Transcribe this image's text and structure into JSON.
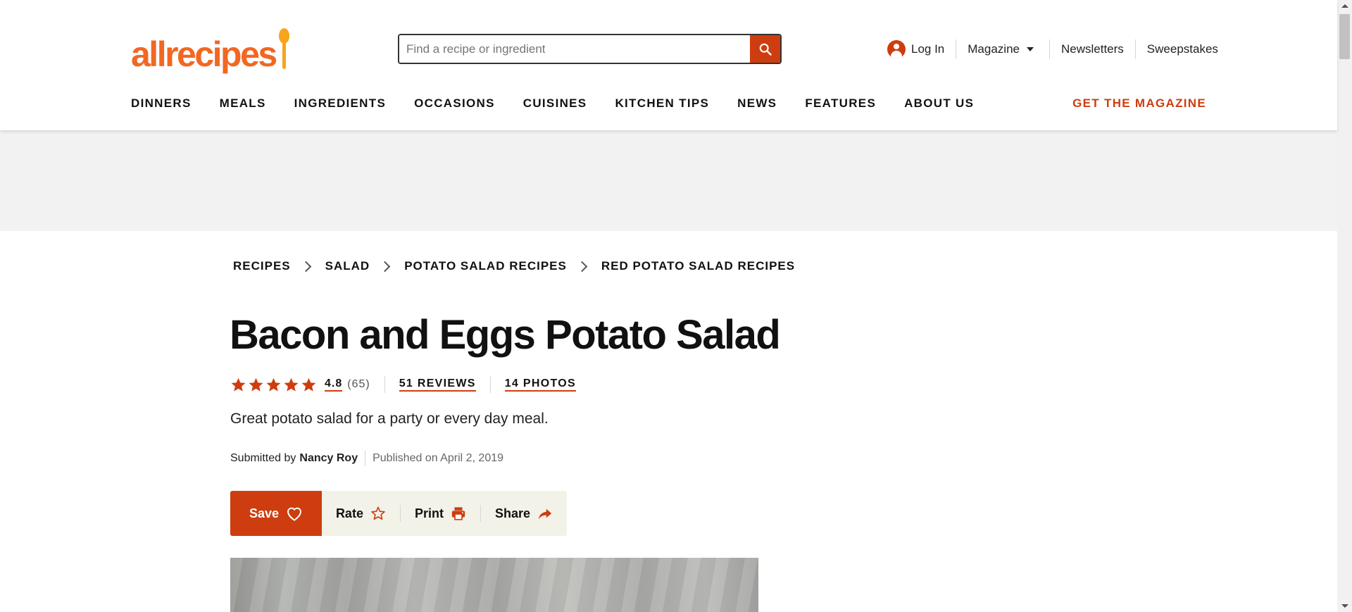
{
  "header": {
    "logo_text": "allrecipes",
    "search": {
      "placeholder": "Find a recipe or ingredient",
      "value": ""
    },
    "utility_nav": {
      "login": "Log In",
      "magazine": "Magazine",
      "newsletters": "Newsletters",
      "sweepstakes": "Sweepstakes"
    },
    "main_nav": [
      "DINNERS",
      "MEALS",
      "INGREDIENTS",
      "OCCASIONS",
      "CUISINES",
      "KITCHEN TIPS",
      "NEWS",
      "FEATURES",
      "ABOUT US"
    ],
    "cta": "GET THE MAGAZINE"
  },
  "breadcrumb": [
    "RECIPES",
    "SALAD",
    "POTATO SALAD RECIPES",
    "RED POTATO SALAD RECIPES"
  ],
  "recipe": {
    "title": "Bacon and Eggs Potato Salad",
    "rating": "4.8",
    "rating_count": "(65)",
    "stars": 4.8,
    "reviews_link": "51 REVIEWS",
    "photos_link": "14 PHOTOS",
    "description": "Great potato salad for a party or every day meal.",
    "submitted_by_label": "Submitted by",
    "author": "Nancy Roy",
    "published": "Published on April 2, 2019"
  },
  "actions": {
    "save": "Save",
    "rate": "Rate",
    "print": "Print",
    "share": "Share"
  },
  "colors": {
    "brand_orange": "#f26722",
    "accent_red": "#ce3d0f",
    "action_bar_bg": "#f2f2e8",
    "ad_band_bg": "#f2f2f2"
  },
  "icons": [
    "search-icon",
    "user-icon",
    "chevron-down-icon",
    "chevron-right-icon",
    "star-icon",
    "heart-icon",
    "star-outline-icon",
    "printer-icon",
    "share-arrow-icon"
  ]
}
